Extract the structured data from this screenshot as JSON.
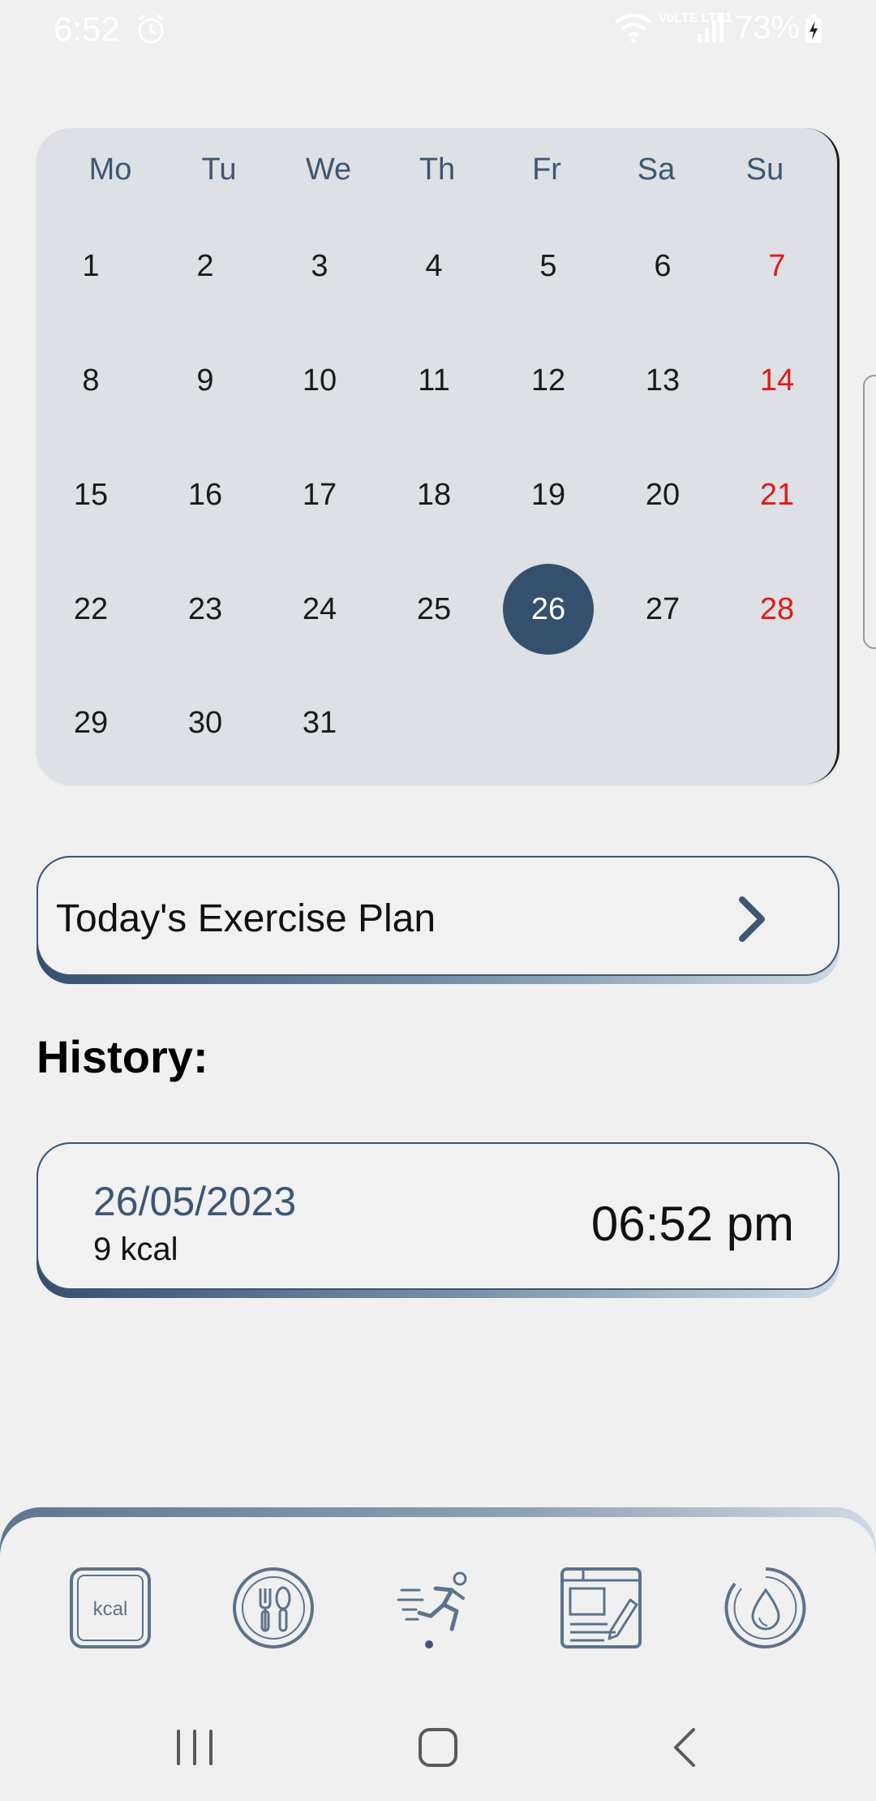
{
  "status_bar": {
    "time": "6:52",
    "network": "VoLTE LTE1",
    "battery": "73%"
  },
  "calendar": {
    "weekdays": [
      "Mo",
      "Tu",
      "We",
      "Th",
      "Fr",
      "Sa",
      "Su"
    ],
    "weeks": [
      [
        "1",
        "2",
        "3",
        "4",
        "5",
        "6",
        "7"
      ],
      [
        "8",
        "9",
        "10",
        "11",
        "12",
        "13",
        "14"
      ],
      [
        "15",
        "16",
        "17",
        "18",
        "19",
        "20",
        "21"
      ],
      [
        "22",
        "23",
        "24",
        "25",
        "26",
        "27",
        "28"
      ],
      [
        "29",
        "30",
        "31",
        "",
        "",
        "",
        ""
      ]
    ],
    "selected_day": "26",
    "colors": {
      "background": "#dde0e4",
      "selected": "#34506d",
      "sunday": "#e01919",
      "weekday_header": "#3d5674"
    }
  },
  "plan": {
    "label": "Today's Exercise Plan",
    "icon": "chevron-right-icon"
  },
  "history": {
    "title": "History:",
    "entries": [
      {
        "date": "26/05/2023",
        "kcal": "9 kcal",
        "time": "06:52 pm"
      }
    ]
  },
  "tabs": [
    {
      "icon": "kcal-icon",
      "label": "kcal"
    },
    {
      "icon": "meal-icon"
    },
    {
      "icon": "exercise-icon",
      "active": true
    },
    {
      "icon": "notes-icon"
    },
    {
      "icon": "water-icon"
    }
  ],
  "nav": {
    "recents": "recents-icon",
    "home": "home-icon",
    "back": "back-icon"
  },
  "accent_color": "#34506d"
}
